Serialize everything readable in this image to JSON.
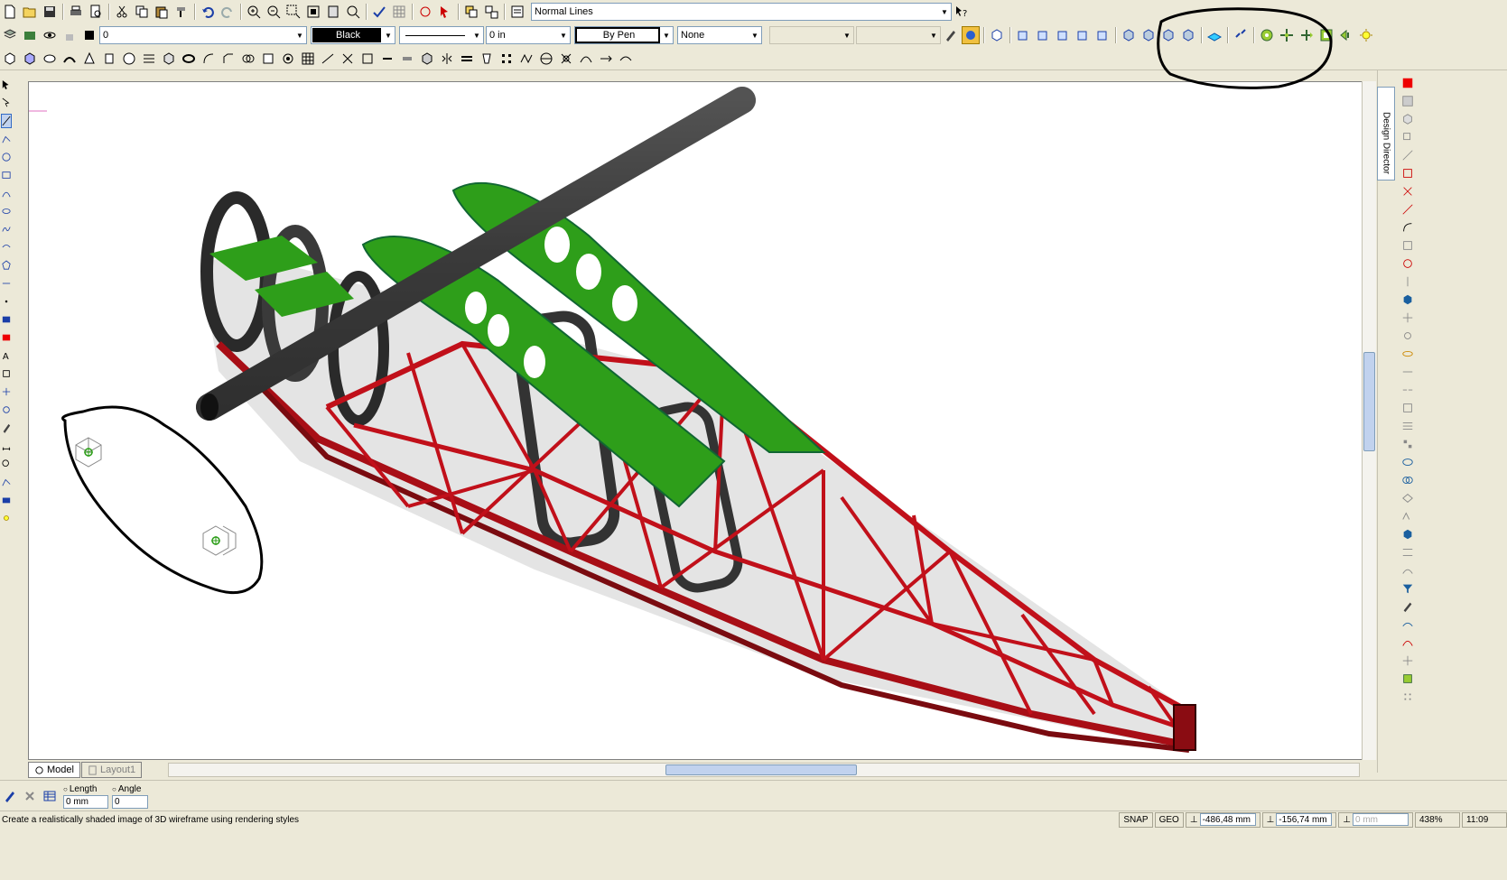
{
  "toolbar1": {
    "style_combo": "Normal Lines",
    "icons": [
      "new-icon",
      "open-icon",
      "save-icon",
      "print-icon",
      "print-preview-icon",
      "cut-icon",
      "copy-icon",
      "paste-icon",
      "format-painter-icon",
      "undo-icon",
      "redo-icon",
      "zoom-in-icon",
      "zoom-out-icon",
      "zoom-window-icon",
      "zoom-extents-icon",
      "zoom-page-icon",
      "zoom-previous-icon",
      "spell-check-icon",
      "grid-icon",
      "rotate-icon",
      "select-icon",
      "group-icon",
      "ungroup-icon",
      "properties-icon",
      "help-pointer-icon"
    ]
  },
  "toolbar2": {
    "layer_value": "0",
    "color_value": "Black",
    "line_style": "",
    "line_width": "0 in",
    "pen_value": "By Pen",
    "fill_value": "None",
    "disabled1": "",
    "disabled2": ""
  },
  "canvas": {
    "accent_green": "#2e9e1a",
    "accent_red": "#c1101a",
    "dark_gray": "#3a3a3a"
  },
  "design_director_label": "Design Director",
  "tabs": [
    {
      "label": "Model",
      "active": true
    },
    {
      "label": "Layout1",
      "active": false
    }
  ],
  "inspector": {
    "length_label": "Length",
    "length_value": "0 mm",
    "angle_label": "Angle",
    "angle_value": "0"
  },
  "status": {
    "message": "Create a realistically shaded image of 3D wireframe using rendering styles",
    "snap": "SNAP",
    "geo": "GEO",
    "x_coord": "-486,48 mm",
    "y_coord": "-156,74 mm",
    "z_coord": "0 mm",
    "zoom": "438%",
    "time": "11:09"
  }
}
